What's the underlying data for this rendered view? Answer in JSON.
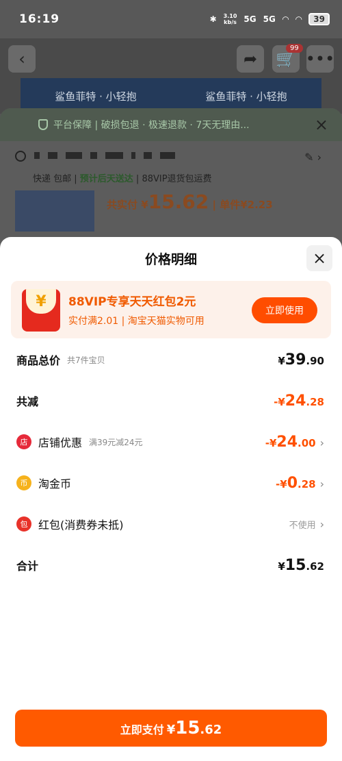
{
  "status_bar": {
    "time": "16:19",
    "speed": "3.10",
    "speed_unit": "kb/s",
    "net1": "5G",
    "net2": "5G",
    "battery": "39"
  },
  "background_page": {
    "cart_badge": "99",
    "banner_items": [
      "鲨鱼菲特 · 小轻抱",
      "鲨鱼菲特 · 小轻抱"
    ]
  },
  "order_sheet": {
    "guarantee_text": "平台保障 | 破损包退 · 极速退款 · 7天无理由...",
    "shipping_prefix": "快递 包邮 | ",
    "shipping_fast": "预计后天送达",
    "shipping_suffix": " | 88VIP退货包运费",
    "total_label": "共实付",
    "total_currency": "¥",
    "total_amount": "15.62",
    "unit_label": " | 单件",
    "unit_price": "¥2.23"
  },
  "modal": {
    "title": "价格明细",
    "promo": {
      "envelope_symbol": "¥",
      "title": "88VIP专享天天红包2元",
      "subtitle": "实付满2.01 | 淘宝天猫实物可用",
      "button": "立即使用"
    },
    "rows": {
      "total": {
        "label": "商品总价",
        "sub": "共7件宝贝",
        "currency": "¥",
        "int": "39",
        "dec": ".90"
      },
      "discount": {
        "label": "共减",
        "currency": "-¥",
        "int": "24",
        "dec": ".28"
      },
      "store": {
        "icon": "店",
        "label": "店铺优惠",
        "sub": "满39元减24元",
        "currency": "-¥",
        "int": "24",
        "dec": ".00"
      },
      "coin": {
        "icon": "币",
        "label": "淘金币",
        "currency": "-¥",
        "int": "0",
        "dec": ".28"
      },
      "redpack": {
        "icon": "包",
        "label": "红包(消费券未抵)",
        "value": "不使用"
      },
      "sum": {
        "label": "合计",
        "currency": "¥",
        "int": "15",
        "dec": ".62"
      }
    },
    "pay_button": {
      "label": "立即支付",
      "currency": "¥",
      "int": "15",
      "dec": ".62"
    }
  },
  "icons": {
    "chevron": "›",
    "close": "×",
    "back": "‹"
  },
  "colors": {
    "accent": "#ff5000",
    "promo_bg": "#fdf1ea",
    "pay_button": "#ff5a00"
  }
}
